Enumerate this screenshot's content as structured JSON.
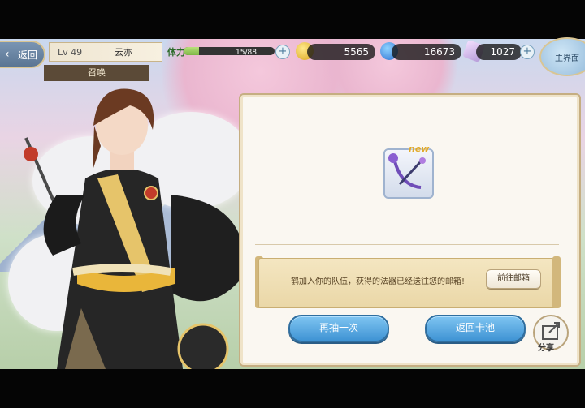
{
  "topbar": {
    "back_label": "返回",
    "player_level": "Lv 49",
    "player_name": "云亦",
    "mode_label": "召唤",
    "stamina_label": "体力",
    "stamina_text": "15/88",
    "stamina_fraction": 0.17,
    "coins": "5565",
    "water_currency": "16673",
    "crystals": "1027",
    "world_label": "主界面"
  },
  "result": {
    "new_badge": "new",
    "notice": "鹤加入你的队伍，获得的法器已经送往您的邮箱!",
    "mail_button": "前往邮箱"
  },
  "actions": {
    "draw_again": "再抽一次",
    "return_pool": "返回卡池",
    "share": "分享"
  },
  "colors": {
    "button_blue": "#3f93d4",
    "panel_bg": "#faf7f1",
    "gold_border": "#c5ae82"
  }
}
